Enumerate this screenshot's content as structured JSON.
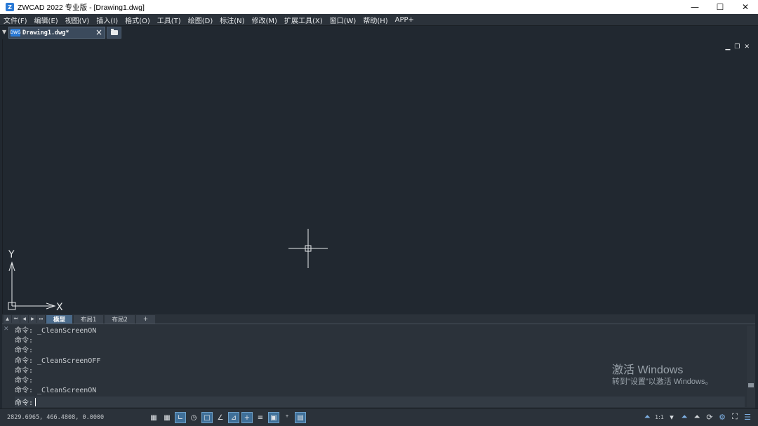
{
  "window": {
    "title": "ZWCAD 2022 专业版 - [Drawing1.dwg]",
    "minimize": "—",
    "maximize": "☐",
    "close": "✕"
  },
  "menu": [
    "文件(F)",
    "编辑(E)",
    "视图(V)",
    "插入(I)",
    "格式(O)",
    "工具(T)",
    "绘图(D)",
    "标注(N)",
    "修改(M)",
    "扩展工具(X)",
    "窗口(W)",
    "帮助(H)",
    "APP+"
  ],
  "doc_tab": {
    "name": "Drawing1.dwg*"
  },
  "ucs": {
    "x_label": "X",
    "y_label": "Y"
  },
  "layout_tabs": [
    "模型",
    "布局1",
    "布局2",
    "+"
  ],
  "command_history": [
    "命令: _CleanScreenON",
    "命令:",
    "命令:",
    "命令: _CleanScreenOFF",
    "命令:",
    "命令:",
    "命令: _CleanScreenON"
  ],
  "command_prompt": "命令:",
  "activation": {
    "title": "激活 Windows",
    "subtitle": "转到\"设置\"以激活 Windows。"
  },
  "status": {
    "coordinates": "2829.6965, 466.4808, 0.0000",
    "annotation_scale": "1:1"
  },
  "colors": {
    "canvas_bg": "#212830",
    "panel_bg": "#2b323a",
    "active_toggle": "#3f6f98",
    "accent": "#2a7ad6"
  }
}
